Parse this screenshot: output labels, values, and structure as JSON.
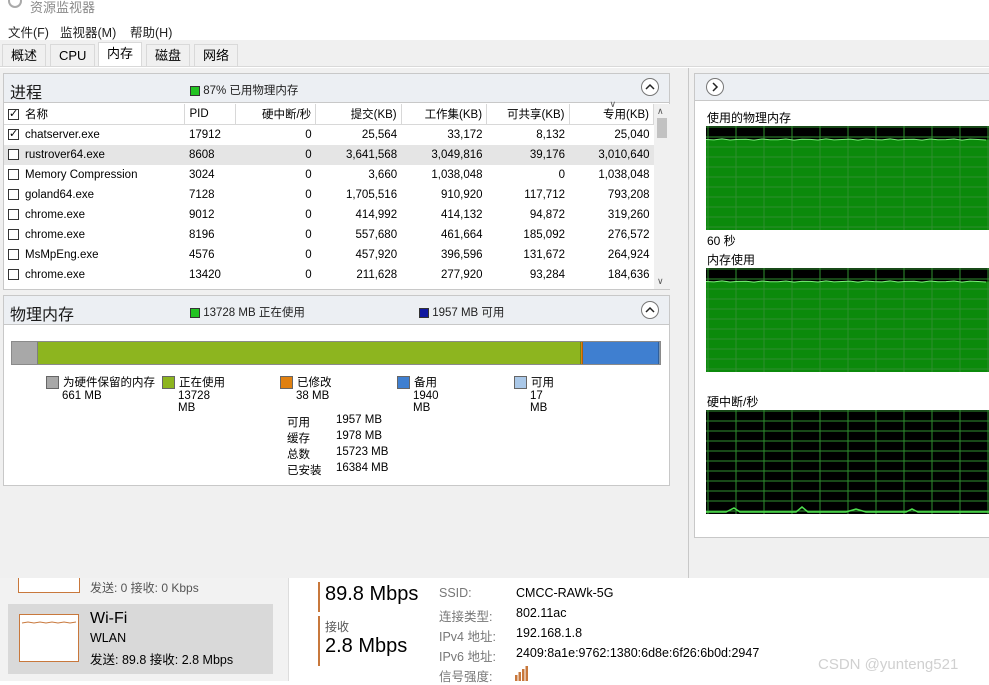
{
  "window": {
    "title": "资源监视器"
  },
  "menu": [
    "文件(F)",
    "监视器(M)",
    "帮助(H)"
  ],
  "tabs": [
    {
      "label": "概述",
      "active": false
    },
    {
      "label": "CPU",
      "active": false
    },
    {
      "label": "内存",
      "active": true
    },
    {
      "label": "磁盘",
      "active": false
    },
    {
      "label": "网络",
      "active": false
    }
  ],
  "processes": {
    "title": "进程",
    "usage_text": "87% 已用物理内存",
    "usage_color": "#22c322",
    "columns": [
      "名称",
      "PID",
      "硬中断/秒",
      "提交(KB)",
      "工作集(KB)",
      "可共享(KB)",
      "专用(KB)"
    ],
    "rows": [
      {
        "checked": true,
        "name": "chatserver.exe",
        "pid": "17912",
        "hf": "0",
        "commit": "25,564",
        "ws": "33,172",
        "share": "8,132",
        "priv": "25,040",
        "selected": false
      },
      {
        "checked": false,
        "name": "rustrover64.exe",
        "pid": "8608",
        "hf": "0",
        "commit": "3,641,568",
        "ws": "3,049,816",
        "share": "39,176",
        "priv": "3,010,640",
        "selected": true
      },
      {
        "checked": false,
        "name": "Memory Compression",
        "pid": "3024",
        "hf": "0",
        "commit": "3,660",
        "ws": "1,038,048",
        "share": "0",
        "priv": "1,038,048",
        "selected": false
      },
      {
        "checked": false,
        "name": "goland64.exe",
        "pid": "7128",
        "hf": "0",
        "commit": "1,705,516",
        "ws": "910,920",
        "share": "117,712",
        "priv": "793,208",
        "selected": false
      },
      {
        "checked": false,
        "name": "chrome.exe",
        "pid": "9012",
        "hf": "0",
        "commit": "414,992",
        "ws": "414,132",
        "share": "94,872",
        "priv": "319,260",
        "selected": false
      },
      {
        "checked": false,
        "name": "chrome.exe",
        "pid": "8196",
        "hf": "0",
        "commit": "557,680",
        "ws": "461,664",
        "share": "185,092",
        "priv": "276,572",
        "selected": false
      },
      {
        "checked": false,
        "name": "MsMpEng.exe",
        "pid": "4576",
        "hf": "0",
        "commit": "457,920",
        "ws": "396,596",
        "share": "131,672",
        "priv": "264,924",
        "selected": false
      },
      {
        "checked": false,
        "name": "chrome.exe",
        "pid": "13420",
        "hf": "0",
        "commit": "211,628",
        "ws": "277,920",
        "share": "93,284",
        "priv": "184,636",
        "selected": false
      }
    ]
  },
  "physical": {
    "title": "物理内存",
    "in_use_text": "13728 MB 正在使用",
    "in_use_color": "#22c322",
    "available_text": "1957 MB 可用",
    "available_color": "#1018a0",
    "bar": [
      {
        "key": "reserved",
        "color": "#a8a8a8",
        "mb": 661
      },
      {
        "key": "in_use",
        "color": "#8db51f",
        "mb": 13728
      },
      {
        "key": "modified",
        "color": "#e08010",
        "mb": 38
      },
      {
        "key": "standby",
        "color": "#3f7fd0",
        "mb": 1940
      },
      {
        "key": "free",
        "color": "#aac8e8",
        "mb": 17
      }
    ],
    "legend": [
      {
        "label": "为硬件保留的内存",
        "value": "661 MB",
        "color": "#a8a8a8"
      },
      {
        "label": "正在使用",
        "value": "13728 MB",
        "color": "#8db51f"
      },
      {
        "label": "已修改",
        "value": "38 MB",
        "color": "#e08010"
      },
      {
        "label": "备用",
        "value": "1940 MB",
        "color": "#3f7fd0"
      },
      {
        "label": "可用",
        "value": "17 MB",
        "color": "#aac8e8"
      }
    ],
    "stats": [
      {
        "label": "可用",
        "value": "1957 MB"
      },
      {
        "label": "缓存",
        "value": "1978 MB"
      },
      {
        "label": "总数",
        "value": "15723 MB"
      },
      {
        "label": "已安装",
        "value": "16384 MB"
      }
    ]
  },
  "graphs": {
    "g1_label": "使用的物理内存",
    "g1_time": "60 秒",
    "g2_label": "内存使用",
    "g3_label": "硬中断/秒"
  },
  "network": {
    "prev_item_text": "发送: 0 接收: 0 Kbps",
    "wifi_title": "Wi-Fi",
    "wifi_sub": "WLAN",
    "wifi_speed": "发送: 89.8 接收: 2.8 Mbps",
    "send_value": "89.8 Mbps",
    "recv_label": "接收",
    "recv_value": "2.8 Mbps",
    "details": [
      {
        "label": "SSID:",
        "value": "CMCC-RAWk-5G"
      },
      {
        "label": "连接类型:",
        "value": "802.11ac"
      },
      {
        "label": "IPv4 地址:",
        "value": "192.168.1.8"
      },
      {
        "label": "IPv6 地址:",
        "value": "2409:8a1e:9762:1380:6d8e:6f26:6b0d:2947"
      },
      {
        "label": "信号强度:",
        "value": ""
      }
    ],
    "watermark": "CSDN @yunteng521",
    "accent": "#c8783c"
  }
}
